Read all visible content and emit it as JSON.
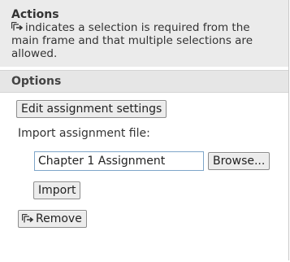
{
  "actions": {
    "title": "Actions",
    "description": "indicates a selection is required from the main frame and that multiple selections are allowed.",
    "icon": "multi-selection-icon"
  },
  "options": {
    "title": "Options",
    "edit_settings_label": "Edit assignment settings",
    "import_file_label": "Import assignment file:",
    "file_value": "Chapter 1 Assignment",
    "browse_label": "Browse...",
    "import_label": "Import",
    "remove_label": "Remove",
    "remove_icon": "multi-selection-icon"
  },
  "colors": {
    "header_bg": "#ebebeb",
    "options_bg": "#e6e6e6",
    "input_border": "#7fa6c9"
  }
}
